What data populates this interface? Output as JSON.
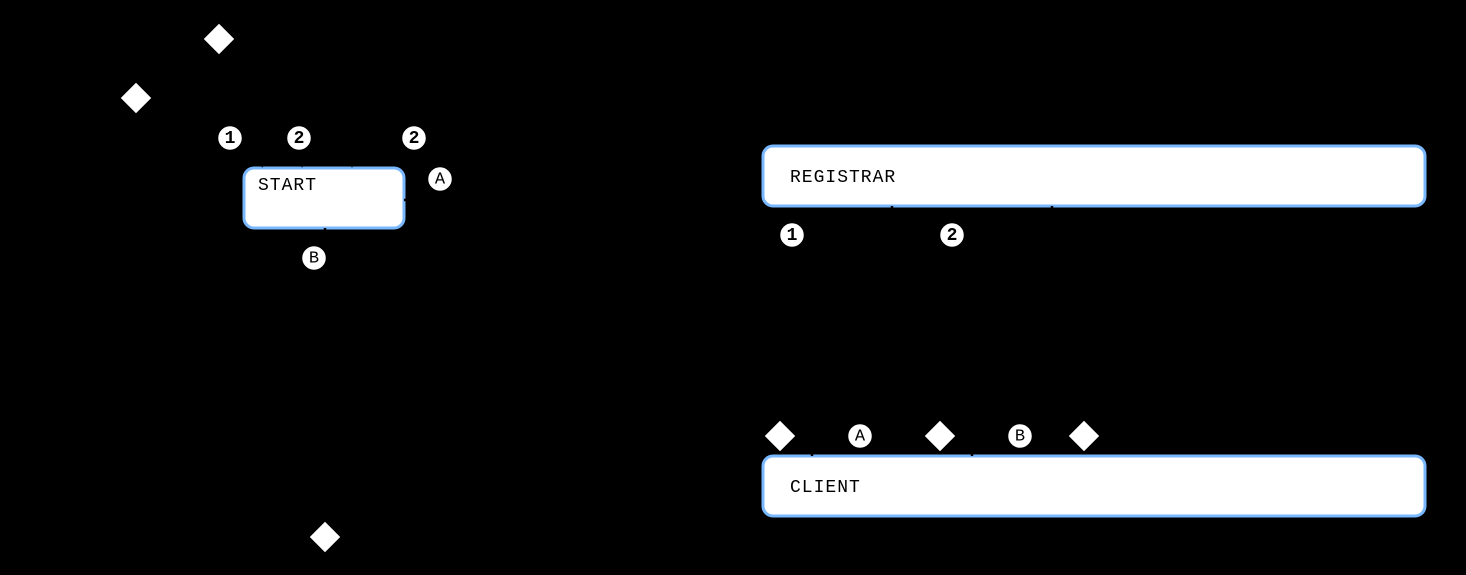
{
  "left": {
    "state_label": "START",
    "badges": {
      "one": "1",
      "two_a": "2",
      "two_b": "2",
      "a": "A",
      "b": "B"
    }
  },
  "right": {
    "top_label": "REGISTRAR",
    "bottom_label": "CLIENT",
    "badges": {
      "one": "1",
      "two": "2",
      "a": "A",
      "b": "B"
    }
  }
}
